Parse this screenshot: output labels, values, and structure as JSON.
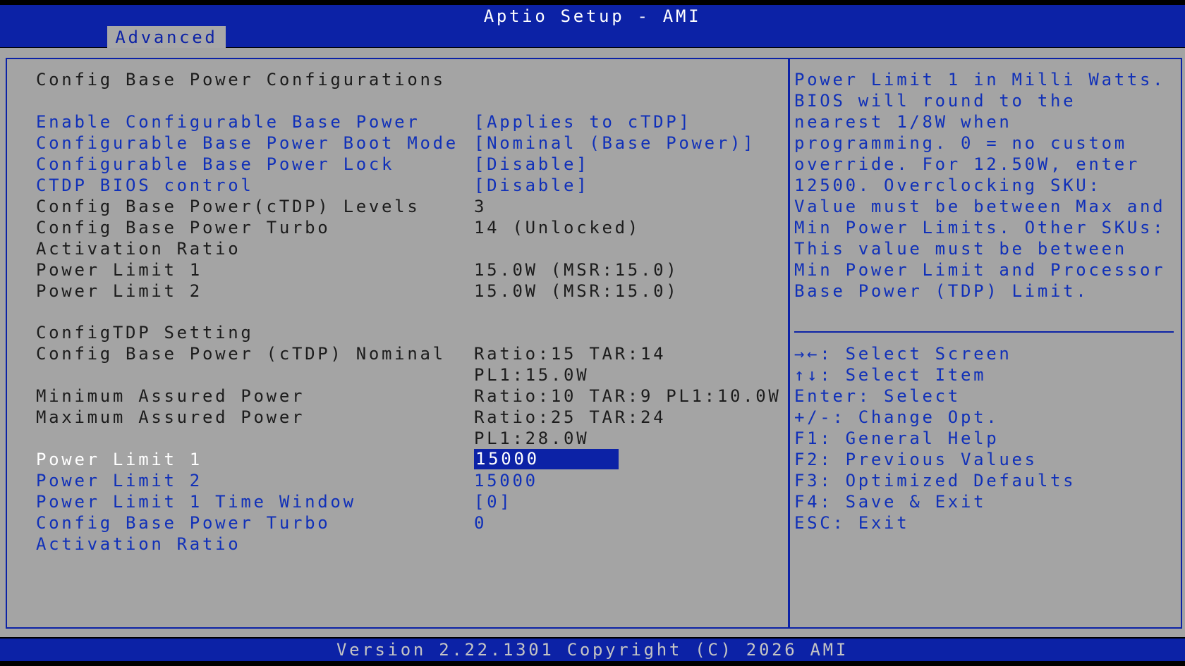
{
  "header": {
    "app_title": "Aptio Setup - AMI",
    "active_tab": "Advanced"
  },
  "page_title": "Config Base Power Configurations",
  "settings": [
    {
      "label": "Enable Configurable Base Power",
      "value": "[Applies to cTDP]"
    },
    {
      "label": "Configurable Base Power Boot Mode",
      "value": "[Nominal (Base Power)]"
    },
    {
      "label": "Configurable Base Power Lock",
      "value": "[Disable]"
    },
    {
      "label": "CTDP BIOS control",
      "value": "[Disable]"
    }
  ],
  "info": [
    {
      "label": "Config Base Power(cTDP) Levels",
      "value": "3"
    },
    {
      "label": "Config Base Power Turbo",
      "label2": "Activation Ratio",
      "value": "14 (Unlocked)"
    },
    {
      "label": "Power Limit 1",
      "value": "15.0W (MSR:15.0)"
    },
    {
      "label": "Power Limit 2",
      "value": "15.0W (MSR:15.0)"
    }
  ],
  "ctdp_section": {
    "heading": "ConfigTDP Setting",
    "rows": [
      {
        "label": "Config Base Power (cTDP) Nominal",
        "value": "Ratio:15 TAR:14",
        "value2": "PL1:15.0W"
      },
      {
        "label": "Minimum Assured Power",
        "value": "Ratio:10 TAR:9 PL1:10.0W"
      },
      {
        "label": "Maximum Assured Power",
        "value": "Ratio:25 TAR:24",
        "value2": "PL1:28.0W"
      }
    ]
  },
  "editable": [
    {
      "label": "Power Limit 1",
      "value": "15000"
    },
    {
      "label": "Power Limit 2",
      "value": "15000"
    },
    {
      "label": "Power Limit 1 Time Window",
      "value": "[0]"
    },
    {
      "label": "Config Base Power Turbo",
      "label2": "Activation Ratio",
      "value": "0"
    }
  ],
  "help": {
    "text": "Power Limit 1 in Milli Watts. BIOS will round to the nearest 1/8W when programming. 0 = no custom override. For 12.50W, enter 12500. Overclocking SKU: Value must be between Max and Min Power Limits. Other SKUs: This value must be between Min Power Limit and Processor Base Power (TDP) Limit."
  },
  "keys": [
    "→←: Select Screen",
    "↑↓: Select Item",
    "Enter: Select",
    "+/-: Change Opt.",
    "F1: General Help",
    "F2: Previous Values",
    "F3: Optimized Defaults",
    "F4: Save & Exit",
    "ESC: Exit"
  ],
  "footer": "Version 2.22.1301 Copyright (C) 2026 AMI"
}
